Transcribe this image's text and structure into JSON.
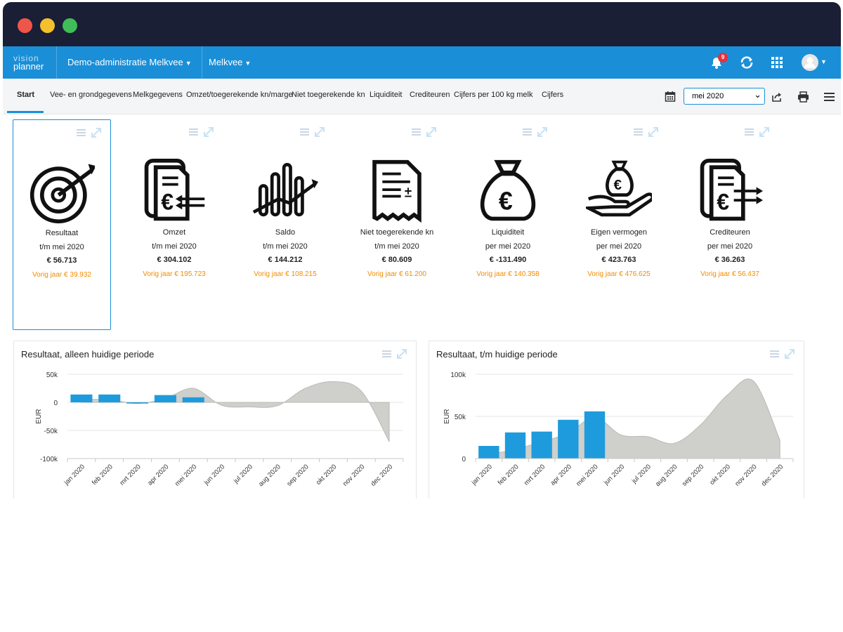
{
  "colors": {
    "brand_blue": "#1a8fd8",
    "titlebar": "#1a1f36",
    "orange": "#f28c00",
    "bar_blue": "#1e9bdc",
    "area_gray": "#cfcfcc",
    "badge_red": "#e8303b"
  },
  "window_controls": [
    "close",
    "minimize",
    "maximize"
  ],
  "topnav": {
    "brand_line1": "vision",
    "brand_line2": "planner",
    "admin_dropdown": "Demo-administratie Melkvee",
    "module_dropdown": "Melkvee",
    "notification_count": "9",
    "icons": [
      "bell-icon",
      "refresh-icon",
      "apps-grid-icon",
      "user-avatar-icon"
    ]
  },
  "tabs": [
    {
      "label": "Start",
      "active": true
    },
    {
      "label": "Vee- en grondgegevens"
    },
    {
      "label": "Melkgegevens"
    },
    {
      "label": "Omzet/toegerekende kn/marge"
    },
    {
      "label": "Niet toegerekende kn"
    },
    {
      "label": "Liquiditeit"
    },
    {
      "label": "Crediteuren"
    },
    {
      "label": "Cijfers per 100 kg melk"
    },
    {
      "label": "Cijfers"
    }
  ],
  "toolbar": {
    "period_select": "mei 2020",
    "icons": [
      "calendar-icon",
      "export-icon",
      "print-icon",
      "menu-icon"
    ]
  },
  "kpis": [
    {
      "title": "Resultaat",
      "period": "t/m mei 2020",
      "value": "€ 56.713",
      "prev": "Vorig jaar € 39.932",
      "icon": "target-icon"
    },
    {
      "title": "Omzet",
      "period": "t/m mei 2020",
      "value": "€ 304.102",
      "prev": "Vorig jaar € 195.723",
      "icon": "invoice-in-icon"
    },
    {
      "title": "Saldo",
      "period": "t/m mei 2020",
      "value": "€ 144.212",
      "prev": "Vorig jaar € 108.215",
      "icon": "trend-bars-icon"
    },
    {
      "title": "Niet toegerekende kn",
      "period": "t/m mei 2020",
      "value": "€ 80.609",
      "prev": "Vorig jaar € 61.200",
      "icon": "receipt-icon"
    },
    {
      "title": "Liquiditeit",
      "period": "per  mei 2020",
      "value": "€ -131.490",
      "prev": "Vorig jaar € 140.358",
      "icon": "money-bag-icon"
    },
    {
      "title": "Eigen vermogen",
      "period": "per  mei 2020",
      "value": "€ 423.763",
      "prev": "Vorig jaar € 476.625",
      "icon": "hand-money-icon"
    },
    {
      "title": "Crediteuren",
      "period": "per  mei 2020",
      "value": "€ 36.263",
      "prev": "Vorig jaar € 56.437",
      "icon": "invoice-out-icon"
    }
  ],
  "chart_data": [
    {
      "type": "bar",
      "title": "Resultaat, alleen huidige periode",
      "ylabel": "EUR",
      "xlabel": "",
      "ylim": [
        -100000,
        50000
      ],
      "yticks": [
        "50k",
        "0",
        "-50k",
        "-100k"
      ],
      "categories": [
        "jan 2020",
        "feb 2020",
        "mrt 2020",
        "apr 2020",
        "mei 2020",
        "jun 2020",
        "jul 2020",
        "aug 2020",
        "sep 2020",
        "okt 2020",
        "nov 2020",
        "dec 2020"
      ],
      "series": [
        {
          "type": "area",
          "values": [
            5000,
            5000,
            -2000,
            7000,
            25000,
            -5000,
            -8000,
            -6000,
            25000,
            37000,
            20000,
            -70000
          ]
        },
        {
          "type": "bar",
          "values": [
            14000,
            14000,
            -2000,
            13000,
            9000,
            null,
            null,
            null,
            null,
            null,
            null,
            null
          ]
        }
      ]
    },
    {
      "type": "bar",
      "title": "Resultaat, t/m huidige periode",
      "ylabel": "EUR",
      "xlabel": "",
      "ylim": [
        0,
        100000
      ],
      "yticks": [
        "100k",
        "50k",
        "0"
      ],
      "categories": [
        "jan 2020",
        "feb 2020",
        "mrt 2020",
        "apr 2020",
        "mei 2020",
        "jun 2020",
        "jul 2020",
        "aug 2020",
        "sep 2020",
        "okt 2020",
        "nov 2020",
        "dec 2020"
      ],
      "series": [
        {
          "type": "area",
          "values": [
            5000,
            11000,
            20000,
            30000,
            49000,
            28000,
            26000,
            18000,
            40000,
            75000,
            92000,
            22000
          ]
        },
        {
          "type": "bar",
          "values": [
            15000,
            31000,
            32000,
            46000,
            56000,
            null,
            null,
            null,
            null,
            null,
            null,
            null
          ]
        }
      ]
    }
  ]
}
